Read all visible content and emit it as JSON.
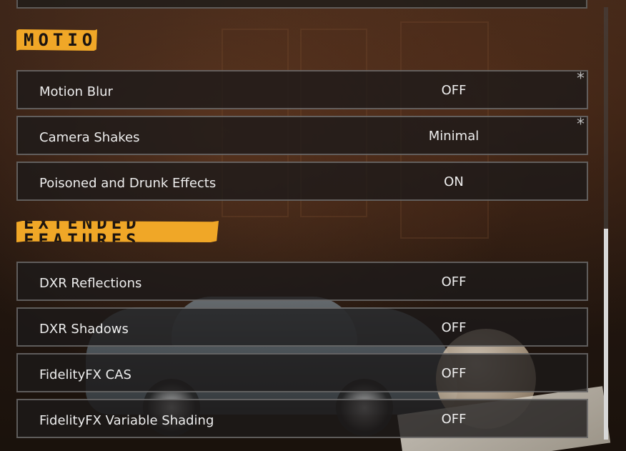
{
  "sections": [
    {
      "title": "MOTION",
      "rows": [
        {
          "label": "Motion Blur",
          "value": "OFF",
          "asterisk": "*"
        },
        {
          "label": "Camera Shakes",
          "value": "Minimal",
          "asterisk": "*"
        },
        {
          "label": "Poisoned and Drunk Effects",
          "value": "ON"
        }
      ]
    },
    {
      "title": "EXTENDED FEATURES",
      "rows": [
        {
          "label": "DXR Reflections",
          "value": "OFF"
        },
        {
          "label": "DXR Shadows",
          "value": "OFF"
        },
        {
          "label": "FidelityFX CAS",
          "value": "OFF"
        },
        {
          "label": "FidelityFX Variable Shading",
          "value": "OFF"
        }
      ]
    }
  ],
  "scrollbar": {
    "position_fraction": 0.52
  },
  "colors": {
    "section_header_bg": "#f0a727",
    "section_header_text": "#1b1410",
    "row_text": "#eeeeee"
  }
}
